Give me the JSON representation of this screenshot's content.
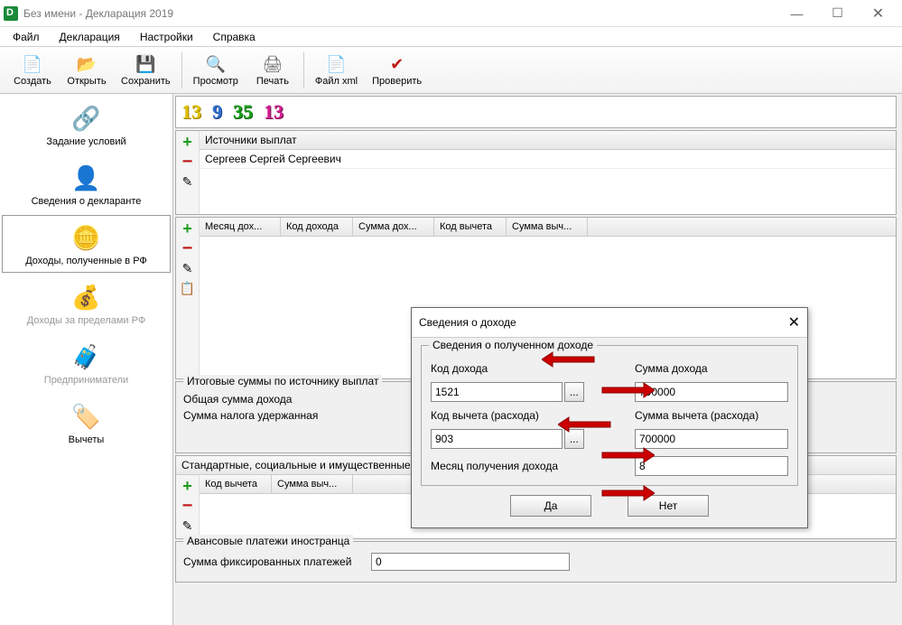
{
  "titlebar": {
    "title": "Без имени - Декларация 2019"
  },
  "menu": {
    "file": "Файл",
    "decl": "Декларация",
    "settings": "Настройки",
    "help": "Справка"
  },
  "toolbar": {
    "create": "Создать",
    "open": "Открыть",
    "save": "Сохранить",
    "view": "Просмотр",
    "print": "Печать",
    "xml": "Файл xml",
    "check": "Проверить"
  },
  "sidebar": {
    "items": [
      {
        "label": "Задание условий"
      },
      {
        "label": "Сведения о декларанте"
      },
      {
        "label": "Доходы, полученные в РФ"
      },
      {
        "label": "Доходы за пределами РФ"
      },
      {
        "label": "Предприниматели"
      },
      {
        "label": "Вычеты"
      }
    ]
  },
  "tabnums": {
    "a": "13",
    "b": "9",
    "c": "35",
    "d": "13"
  },
  "sources": {
    "header": "Источники выплат",
    "row0": "Сергеев Сергей Сергеевич"
  },
  "inc_cols": {
    "c1": "Месяц дох...",
    "c2": "Код дохода",
    "c3": "Сумма дох...",
    "c4": "Код вычета",
    "c5": "Сумма выч..."
  },
  "totals": {
    "legend": "Итоговые суммы по источнику выплат",
    "l1": "Общая сумма дохода",
    "l2": "Сумма налога удержанная"
  },
  "std": {
    "legend": "Стандартные, социальные и имущественные вычеты",
    "c1": "Код вычета",
    "c2": "Сумма выч..."
  },
  "advance": {
    "legend": "Авансовые платежи иностранца",
    "l1": "Сумма фиксированных платежей",
    "v1": "0"
  },
  "dialog": {
    "title": "Сведения о доходе",
    "legend": "Сведения о полученном доходе",
    "lbl_code": "Код дохода",
    "lbl_sum": "Сумма дохода",
    "lbl_dcode": "Код вычета (расхода)",
    "lbl_dsum": "Сумма вычета (расхода)",
    "lbl_month": "Месяц получения дохода",
    "v_code": "1521",
    "v_sum": "700000",
    "v_dcode": "903",
    "v_dsum": "700000",
    "v_month": "8",
    "dots": "...",
    "yes": "Да",
    "no": "Нет"
  }
}
